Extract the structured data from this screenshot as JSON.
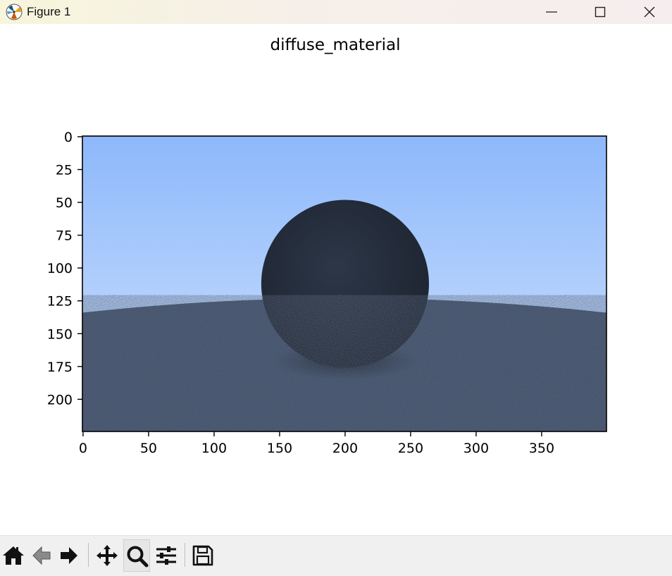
{
  "window": {
    "title": "Figure 1"
  },
  "figure": {
    "title": "diffuse_material",
    "image_description": "rendered scene: sky gradient, dark noisy diffuse sphere resting on a large diffuse ground sphere",
    "colors": {
      "sky_top": "#8db8fb",
      "sky_bottom": "#d2e3fd",
      "ground": "#3f4f6a",
      "sphere": "#242d3b",
      "noise": "#1d2431"
    }
  },
  "chart_data": {
    "type": "image",
    "title": "diffuse_material",
    "xlim": [
      -0.5,
      399.5
    ],
    "ylim": [
      224.5,
      -0.5
    ],
    "xticks": [
      0,
      50,
      100,
      150,
      200,
      250,
      300,
      350
    ],
    "yticks": [
      0,
      25,
      50,
      75,
      100,
      125,
      150,
      175,
      200
    ],
    "xticklabels": [
      "0",
      "50",
      "100",
      "150",
      "200",
      "250",
      "300",
      "350"
    ],
    "yticklabels": [
      "0",
      "25",
      "50",
      "75",
      "100",
      "125",
      "150",
      "175",
      "200"
    ],
    "image_size": {
      "width": 400,
      "height": 225
    },
    "sphere": {
      "center_x": 200,
      "center_y": 112,
      "radius": 64
    },
    "horizon": {
      "edge_y": 134,
      "center_y": 123
    },
    "xlabel": "",
    "ylabel": "",
    "grid": false
  },
  "toolbar": {
    "tools": [
      {
        "name": "home-button",
        "icon": "home-icon"
      },
      {
        "name": "back-button",
        "icon": "arrow-left-icon"
      },
      {
        "name": "forward-button",
        "icon": "arrow-right-icon"
      },
      {
        "name": "pan-button",
        "icon": "move-icon"
      },
      {
        "name": "zoom-button",
        "icon": "magnifier-icon",
        "active": true
      },
      {
        "name": "configure-subplots-button",
        "icon": "sliders-icon"
      },
      {
        "name": "save-button",
        "icon": "floppy-disk-icon"
      }
    ]
  }
}
